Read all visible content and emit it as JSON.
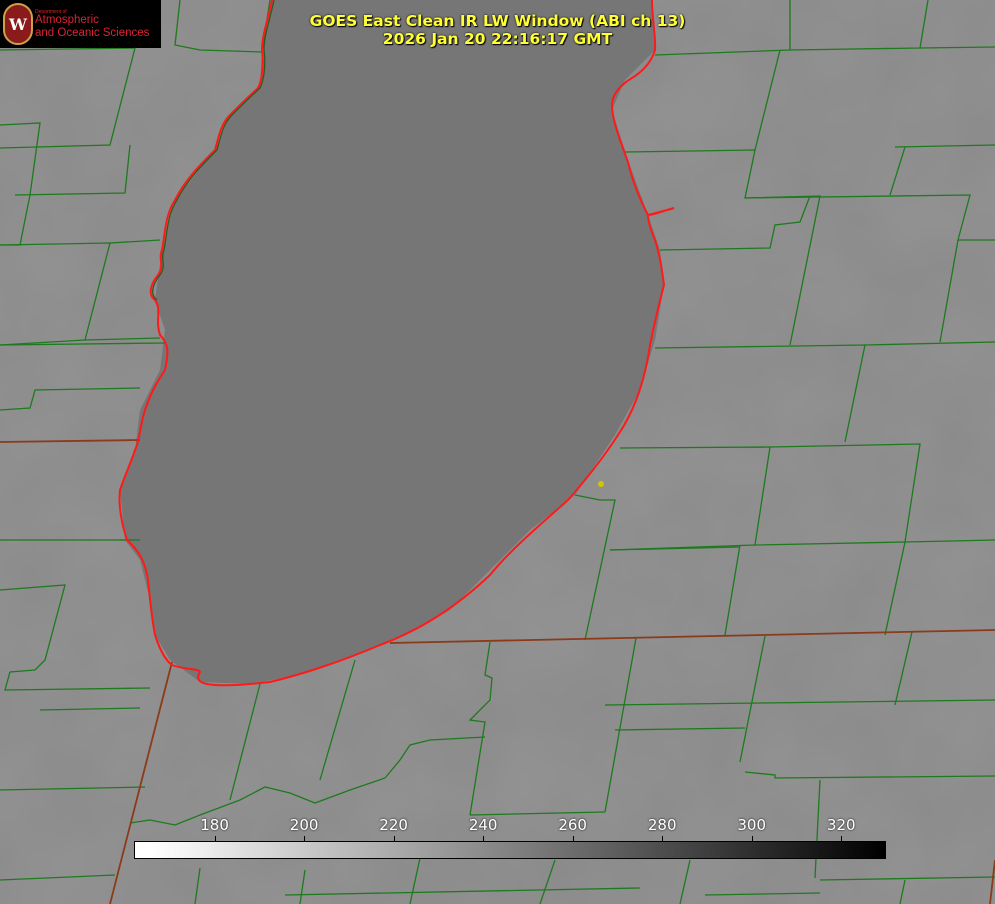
{
  "title": {
    "line1": "GOES East Clean IR LW Window (ABI ch 13)",
    "line2": "2026 Jan 20 22:16:17 GMT"
  },
  "logo": {
    "department": "Department of",
    "line1": "Atmospheric",
    "line2": "and Oceanic Sciences",
    "seal_letter": "W"
  },
  "colorbar": {
    "min": 162,
    "max": 330,
    "ticks": [
      "180",
      "200",
      "220",
      "240",
      "260",
      "280",
      "300",
      "320"
    ],
    "colors": {
      "low": "#ffffff",
      "high": "#000000"
    }
  },
  "colors": {
    "county_lines": "#1e7a1e",
    "state_lines": "#8b3a1a",
    "lake_outline": "#ff2020",
    "title": "#ffff33",
    "background_gray": "#8a8a8a",
    "lake_gray": "#757575",
    "marker": "#d4c400"
  },
  "icons": {
    "logo": "uw-madison-seal-icon",
    "marker": "city-dot-icon"
  }
}
